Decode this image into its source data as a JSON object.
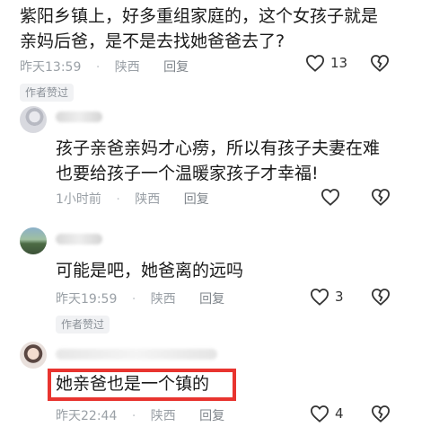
{
  "comment_top": {
    "text_line1": "紫阳乡镇上，好多重组家庭的，这个女孩子就是",
    "text_line2": "亲妈后爸，是不是去找她爸爸去了?",
    "time": "昨天13:59",
    "location": "陕西",
    "reply_label": "回复",
    "like_count": "13",
    "badge": "作者赞过"
  },
  "comment_1": {
    "text_line1": "孩子亲爸亲妈才心痨，所以有孩子夫妻在难",
    "text_line2": "也要给孩子一个温暖家孩子才幸福!",
    "time": "1小时前",
    "location": "陕西",
    "reply_label": "回复",
    "like_count": ""
  },
  "comment_2": {
    "text": "可能是吧，她爸离的远吗",
    "time": "昨天19:59",
    "location": "陕西",
    "reply_label": "回复",
    "like_count": "3",
    "badge": "作者赞过"
  },
  "comment_3": {
    "text": "她亲爸也是一个镇的",
    "time": "昨天22:44",
    "location": "陕西",
    "reply_label": "回复",
    "like_count": "4"
  },
  "colors": {
    "highlight": "#e8342f",
    "meta_text": "#9aa0a6"
  },
  "icons": [
    "heart-icon",
    "broken-heart-icon"
  ]
}
